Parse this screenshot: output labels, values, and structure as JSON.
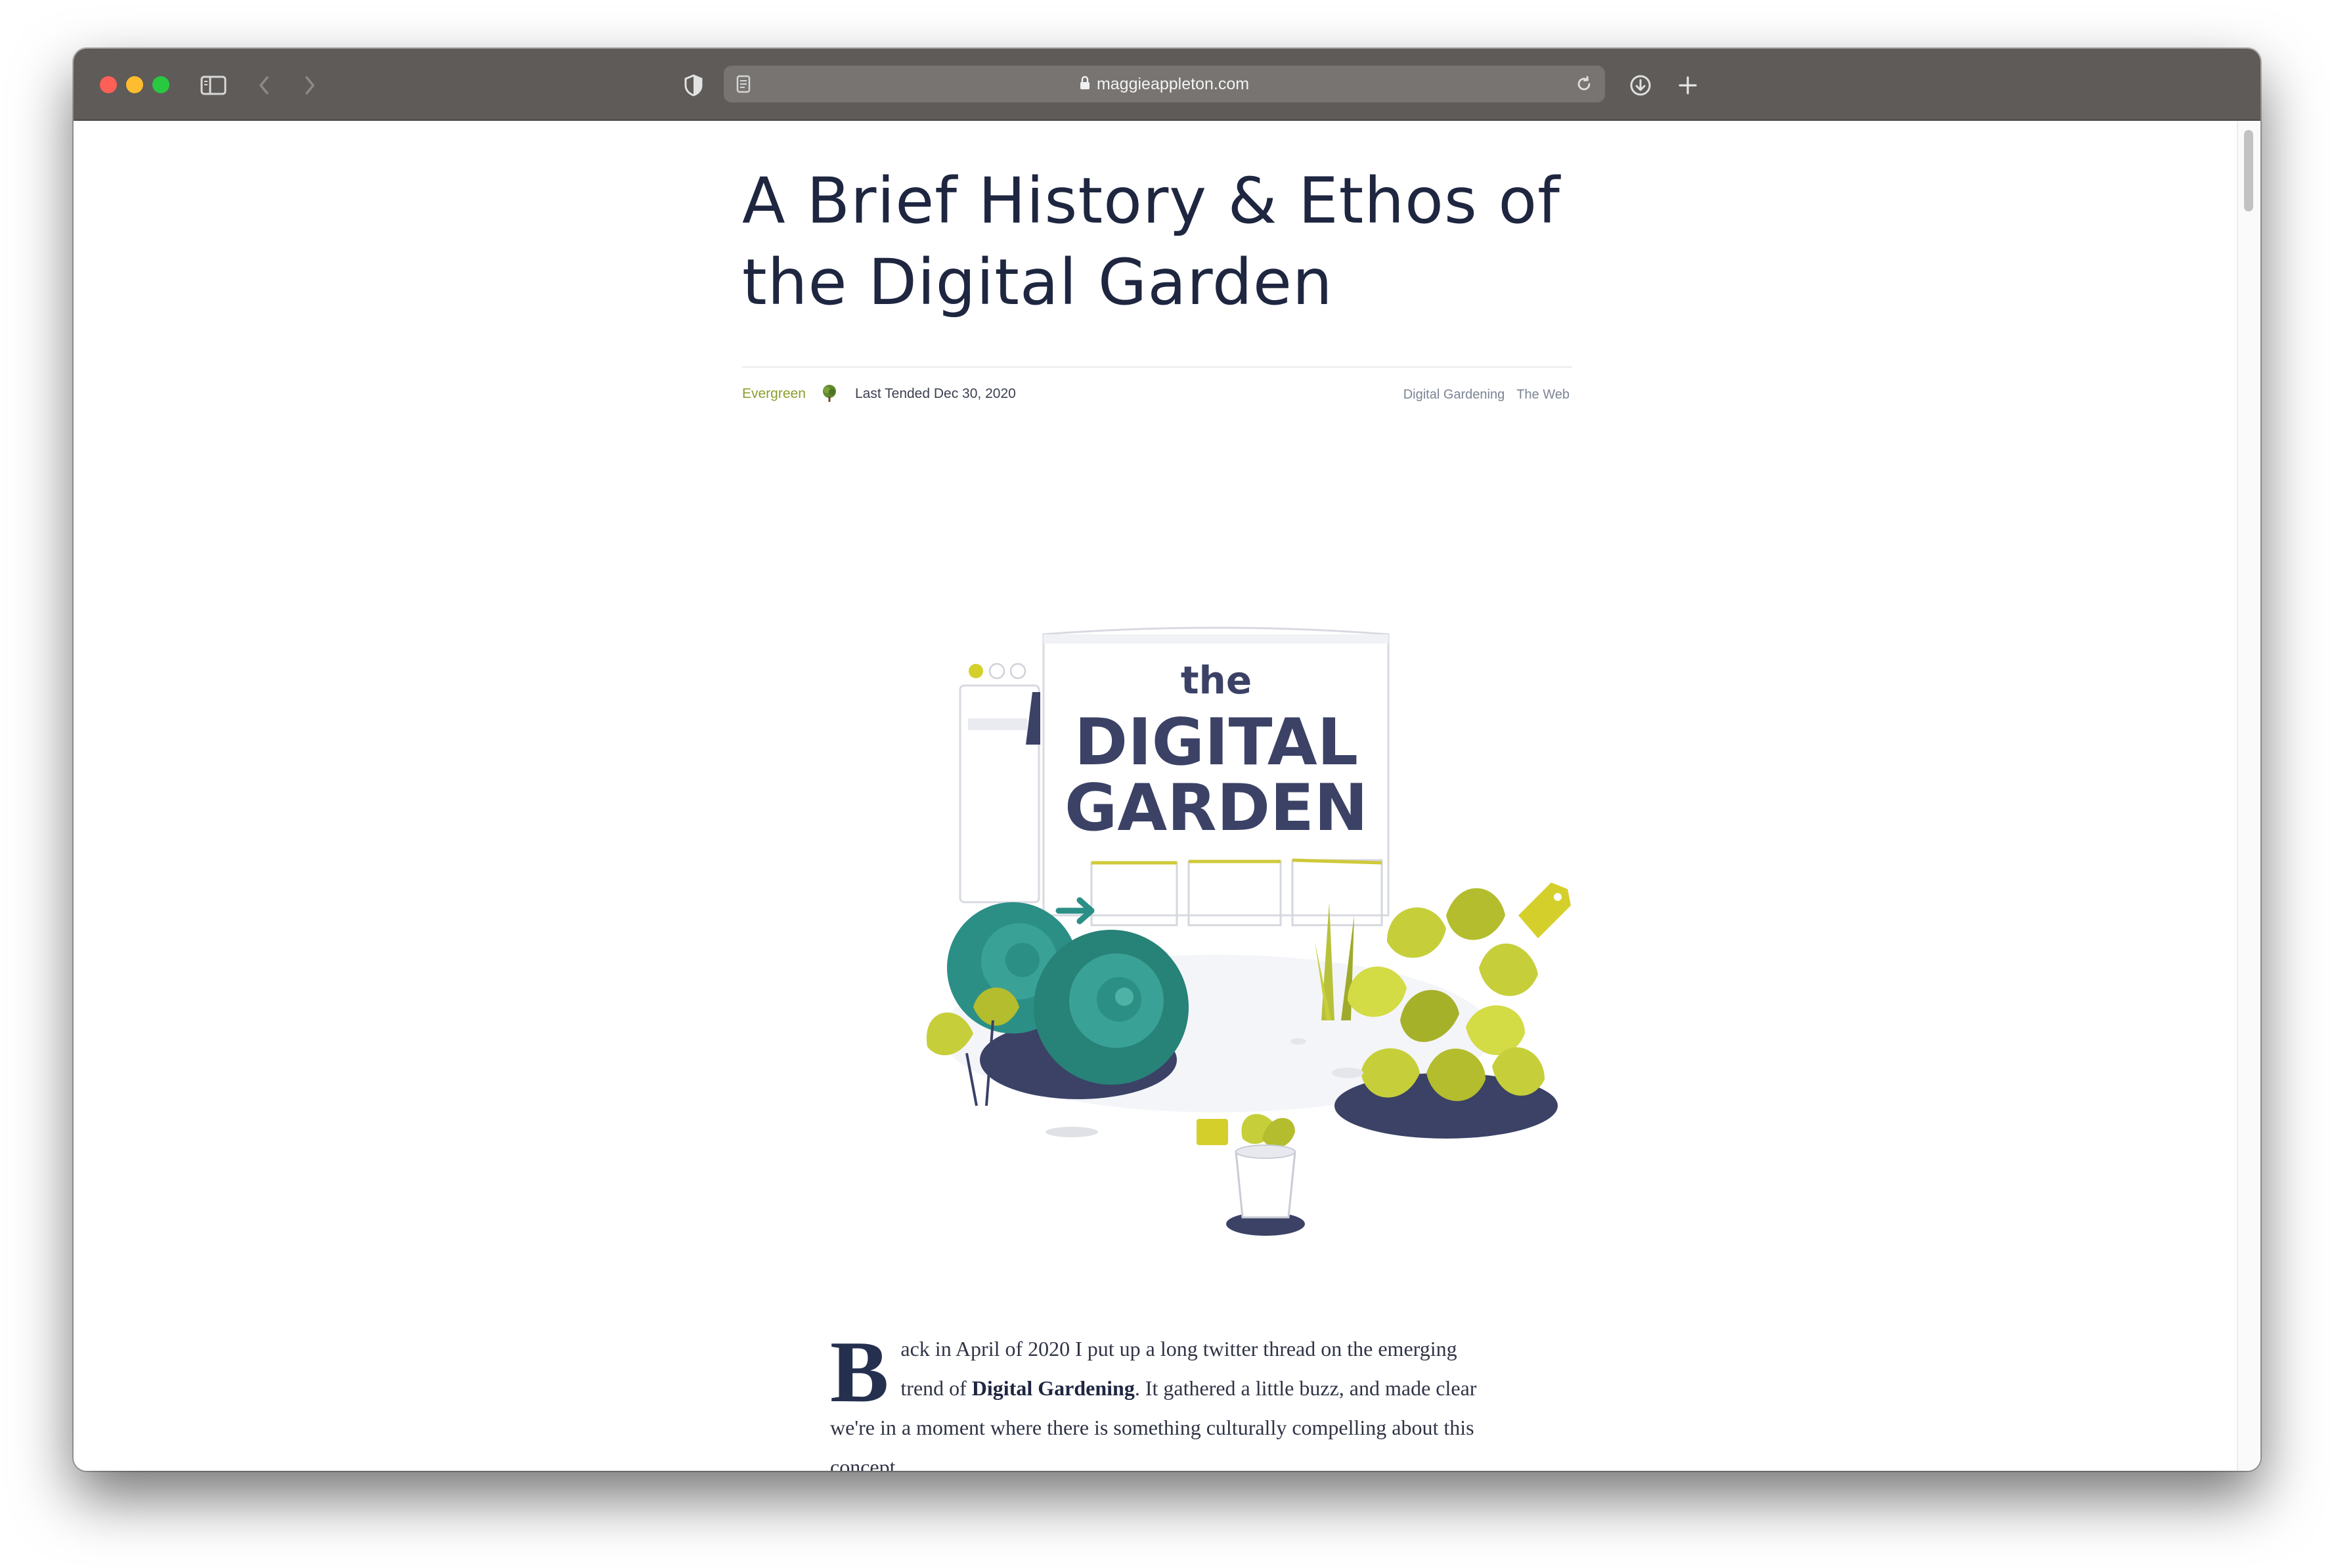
{
  "browser": {
    "url": "maggieappleton.com"
  },
  "article": {
    "title": "A Brief History & Ethos of the Digital Garden",
    "status": "Evergreen",
    "tended_label": "Last Tended Dec 30, 2020",
    "topics": [
      "Digital Gardening",
      "The Web"
    ],
    "hero": {
      "line1": "the",
      "line2": "DIGITAL",
      "line3": "GARDEN"
    },
    "body": {
      "dropcap": "B",
      "p1_a": "ack in April of 2020 I put up a long twitter thread on the emerging trend of ",
      "p1_keyword": "Digital Gardening",
      "p1_b": ". It gathered a little buzz, and made clear we're in a moment where there is something culturally compelling about this concept."
    }
  },
  "colors": {
    "toolbar": "#5e5b58",
    "title": "#1e2640",
    "evergreen": "#8a9e2a",
    "teal": "#2b8f86",
    "chartreuse": "#c6cf3a",
    "navy": "#3b4266"
  }
}
